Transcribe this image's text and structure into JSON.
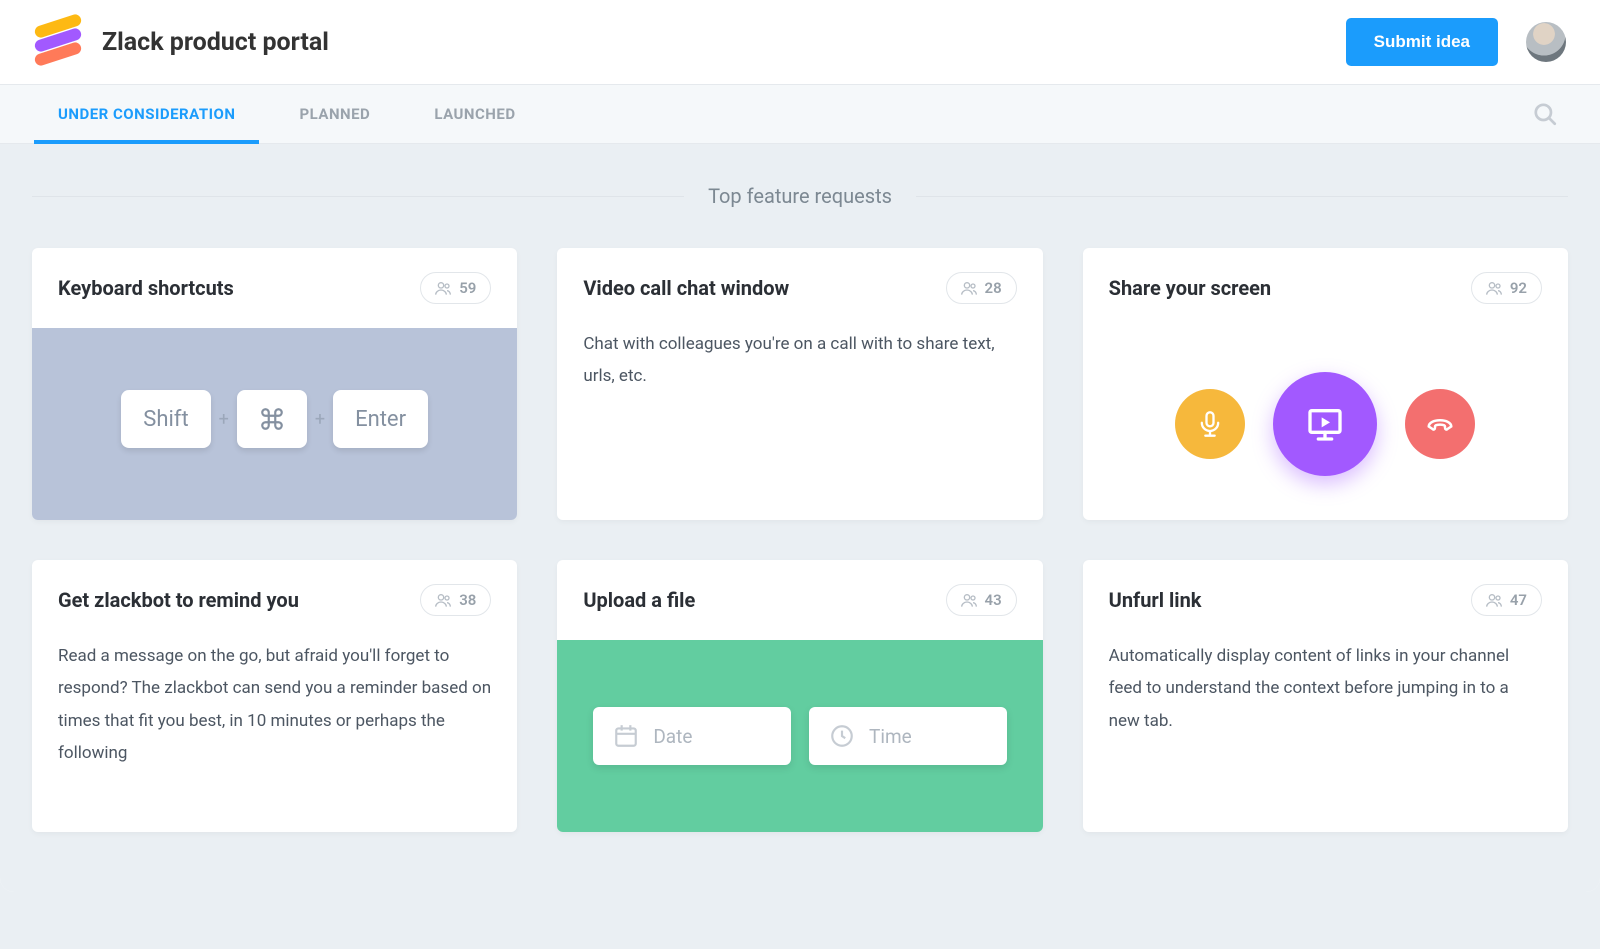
{
  "header": {
    "title": "Zlack product portal",
    "submit_label": "Submit idea"
  },
  "tabs": [
    {
      "label": "UNDER CONSIDERATION",
      "active": true
    },
    {
      "label": "PLANNED",
      "active": false
    },
    {
      "label": "LAUNCHED",
      "active": false
    }
  ],
  "section_title": "Top feature requests",
  "cards": [
    {
      "title": "Keyboard shortcuts",
      "votes": "59",
      "kind": "keyboard",
      "keys": [
        "Shift",
        "⌘",
        "Enter"
      ]
    },
    {
      "title": "Video call chat window",
      "votes": "28",
      "kind": "text",
      "body": "Chat with colleagues you're on a call with to share text, urls, etc."
    },
    {
      "title": "Share your screen",
      "votes": "92",
      "kind": "share"
    },
    {
      "title": "Get zlackbot to remind you",
      "votes": "38",
      "kind": "text",
      "body": "Read a message on the go, but afraid you'll forget to respond? The zlackbot can send you a reminder based on times that fit you best, in 10 minutes or perhaps the following"
    },
    {
      "title": "Upload a file",
      "votes": "43",
      "kind": "upload",
      "fields": [
        "Date",
        "Time"
      ]
    },
    {
      "title": "Unfurl link",
      "votes": "47",
      "kind": "text",
      "body": "Automatically display content of links in your channel feed to understand the context before jumping in to a new tab."
    }
  ]
}
